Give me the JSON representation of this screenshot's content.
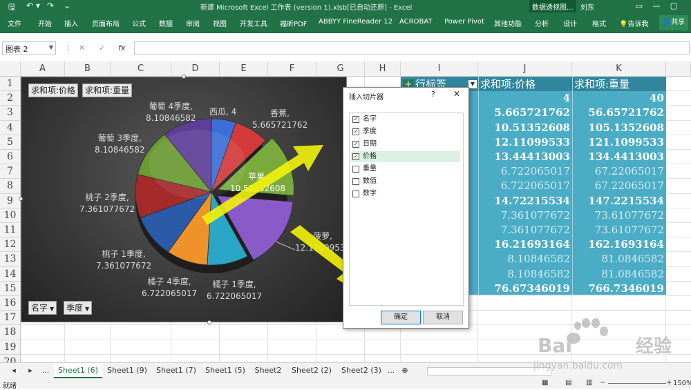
{
  "app": {
    "title": "新建 Microsoft Excel 工作表 (version 1).xlsb[已自动还原] - Excel",
    "context_tab": "数据透视图...",
    "user": "刘东"
  },
  "ribbon": {
    "tabs": [
      "文件",
      "开始",
      "插入",
      "页面布局",
      "公式",
      "数据",
      "审阅",
      "视图",
      "开发工具",
      "福昕PDF",
      "ABBYY FineReader 12",
      "ACROBAT",
      "Power Pivot",
      "其他功能",
      "分析",
      "设计",
      "格式"
    ],
    "tell_me": "告诉我",
    "share": "共享"
  },
  "formula_bar": {
    "name_box": "图表 2",
    "fx": "fx",
    "value": ""
  },
  "grid": {
    "columns": [
      "A",
      "B",
      "C",
      "D",
      "E",
      "F",
      "G",
      "H",
      "I",
      "J",
      "K"
    ],
    "rows": [
      "1",
      "2",
      "3",
      "4",
      "5",
      "6",
      "7",
      "8",
      "9",
      "10",
      "11",
      "12",
      "13",
      "14",
      "15",
      "16",
      "17",
      "18",
      "19",
      "20"
    ]
  },
  "pivot": {
    "header_i": "行标签",
    "header_j": "求和项:价格",
    "header_k": "求和项:重量",
    "rows": [
      {
        "j": "4",
        "k": "40",
        "style": "w"
      },
      {
        "j": "5.665721762",
        "k": "56.65721762",
        "style": "w"
      },
      {
        "j": "10.51352608",
        "k": "105.1352608",
        "style": "w"
      },
      {
        "j": "12.11099533",
        "k": "121.1099533",
        "style": "w"
      },
      {
        "j": "13.44413003",
        "k": "134.4413003",
        "style": "w"
      },
      {
        "j": "6.722065017",
        "k": "67.22065017",
        "style": "lt"
      },
      {
        "j": "6.722065017",
        "k": "67.22065017",
        "style": "lt"
      },
      {
        "j": "14.72215534",
        "k": "147.2215534",
        "style": "w"
      },
      {
        "j": "7.361077672",
        "k": "73.61077672",
        "style": "lt"
      },
      {
        "j": "7.361077672",
        "k": "73.61077672",
        "style": "lt"
      },
      {
        "j": "16.21693164",
        "k": "162.1693164",
        "style": "w"
      },
      {
        "j": "8.10846582",
        "k": "81.0846582",
        "style": "lt"
      },
      {
        "j": "8.10846582",
        "k": "81.0846582",
        "style": "lt"
      },
      {
        "j": "76.67346019",
        "k": "766.7346019",
        "style": "w"
      }
    ]
  },
  "chart": {
    "value_buttons": [
      "求和项:价格",
      "求和项:重量"
    ],
    "axis_buttons": [
      "名字",
      "季度"
    ]
  },
  "chart_data": {
    "type": "pie",
    "slices": [
      {
        "label": "西瓜, 4",
        "value": 4,
        "color": "#3c6fd6"
      },
      {
        "label": "香蕉, 5.665721762",
        "value": 5.665721762,
        "color": "#d43a3a"
      },
      {
        "label": "苹果, 10.51352608",
        "value": 10.51352608,
        "color": "#7aaa3c"
      },
      {
        "label": "菠萝, 12.11099533",
        "value": 12.11099533,
        "color": "#8a5ac8"
      },
      {
        "label": "橘子 1季度, 6.722065017",
        "value": 6.722065017,
        "color": "#2aa6c6"
      },
      {
        "label": "橘子 4季度, 6.722065017",
        "value": 6.722065017,
        "color": "#f0922a"
      },
      {
        "label": "桃子 1季度, 7.361077672",
        "value": 7.361077672,
        "color": "#2a5aa8"
      },
      {
        "label": "桃子 2季度, 7.361077672",
        "value": 7.361077672,
        "color": "#a52a2a"
      },
      {
        "label": "葡萄 3季度, 8.10846582",
        "value": 8.10846582,
        "color": "#6a9a32"
      },
      {
        "label": "葡萄 4季度, 8.10846582",
        "value": 8.10846582,
        "color": "#5e3e96"
      }
    ]
  },
  "chart_labels": {
    "xigua": [
      "西瓜, 4"
    ],
    "xiangjiao": [
      "香蕉,",
      "5.665721762"
    ],
    "pingguo": [
      "苹果,",
      "10.51352608"
    ],
    "boluo": [
      "菠萝,",
      "12.11099533"
    ],
    "juzi1": [
      "橘子 1季度,",
      "6.722065017"
    ],
    "juzi4": [
      "橘子 4季度,",
      "6.722065017"
    ],
    "taozi1": [
      "桃子 1季度,",
      "7.361077672"
    ],
    "taozi2": [
      "桃子 2季度,",
      "7.361077672"
    ],
    "putao3": [
      "葡萄 3季度,",
      "8.10846582"
    ],
    "putao4": [
      "葡萄 4季度,",
      "8.10846582"
    ]
  },
  "dialog": {
    "title": "插入切片器",
    "help": "?",
    "close": "✕",
    "ok": "确定",
    "cancel": "取消",
    "fields": [
      {
        "label": "名字",
        "checked": true
      },
      {
        "label": "季度",
        "checked": true
      },
      {
        "label": "日期",
        "checked": true
      },
      {
        "label": "价格",
        "checked": true
      },
      {
        "label": "重量",
        "checked": false
      },
      {
        "label": "数值",
        "checked": false
      },
      {
        "label": "数字",
        "checked": false
      }
    ]
  },
  "sheets": [
    "Sheet1 (6)",
    "Sheet1 (9)",
    "Sheet1 (7)",
    "Sheet1 (5)",
    "Sheet2",
    "Sheet2 (2)",
    "Sheet2 (3)"
  ],
  "status": {
    "ready": "就绪",
    "zoom": "150%"
  },
  "watermark": {
    "logo": "Baidu经验",
    "url": "jingyan.baidu.com"
  },
  "colors": {
    "excel_green": "#217346",
    "pivot_blue": "#4bacc6",
    "arrow_yellow": "#f2f20a"
  }
}
